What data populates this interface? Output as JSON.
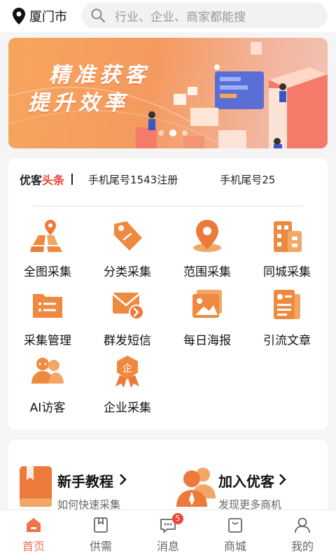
{
  "header": {
    "city": "厦门市",
    "search_placeholder": "行业、企业、商家都能搜"
  },
  "banner": {
    "line1": "精准获客",
    "line2": "提升效率",
    "slides": 3,
    "active_slide": 1
  },
  "news": {
    "brand_prefix": "优客",
    "brand_suffix": "头条",
    "messages": [
      "手机尾号1543注册",
      "手机尾号25"
    ]
  },
  "grid": [
    {
      "label": "全图采集",
      "icon": "map-pin-grid-icon"
    },
    {
      "label": "分类采集",
      "icon": "tag-icon"
    },
    {
      "label": "范围采集",
      "icon": "location-pin-icon"
    },
    {
      "label": "同城采集",
      "icon": "building-icon"
    },
    {
      "label": "采集管理",
      "icon": "folder-list-icon"
    },
    {
      "label": "群发短信",
      "icon": "envelope-forward-icon"
    },
    {
      "label": "每日海报",
      "icon": "picture-icon"
    },
    {
      "label": "引流文章",
      "icon": "article-icon"
    },
    {
      "label": "AI访客",
      "icon": "people-icon"
    },
    {
      "label": "企业采集",
      "icon": "enterprise-badge-icon"
    }
  ],
  "promo": {
    "left": {
      "title": "新手教程",
      "subtitle": "如何快速采集"
    },
    "right": {
      "title": "加入优客",
      "subtitle": "发现更多商机"
    }
  },
  "tabs": [
    {
      "label": "首页",
      "icon": "home-icon",
      "active": true
    },
    {
      "label": "供需",
      "icon": "bookmark-icon",
      "active": false
    },
    {
      "label": "消息",
      "icon": "chat-icon",
      "active": false,
      "badge": "5"
    },
    {
      "label": "商城",
      "icon": "shop-bag-icon",
      "active": false
    },
    {
      "label": "我的",
      "icon": "user-icon",
      "active": false
    }
  ],
  "colors": {
    "accent": "#f0714a",
    "icon_orange": "#ee8a3f",
    "headline_red": "#f0433a"
  }
}
